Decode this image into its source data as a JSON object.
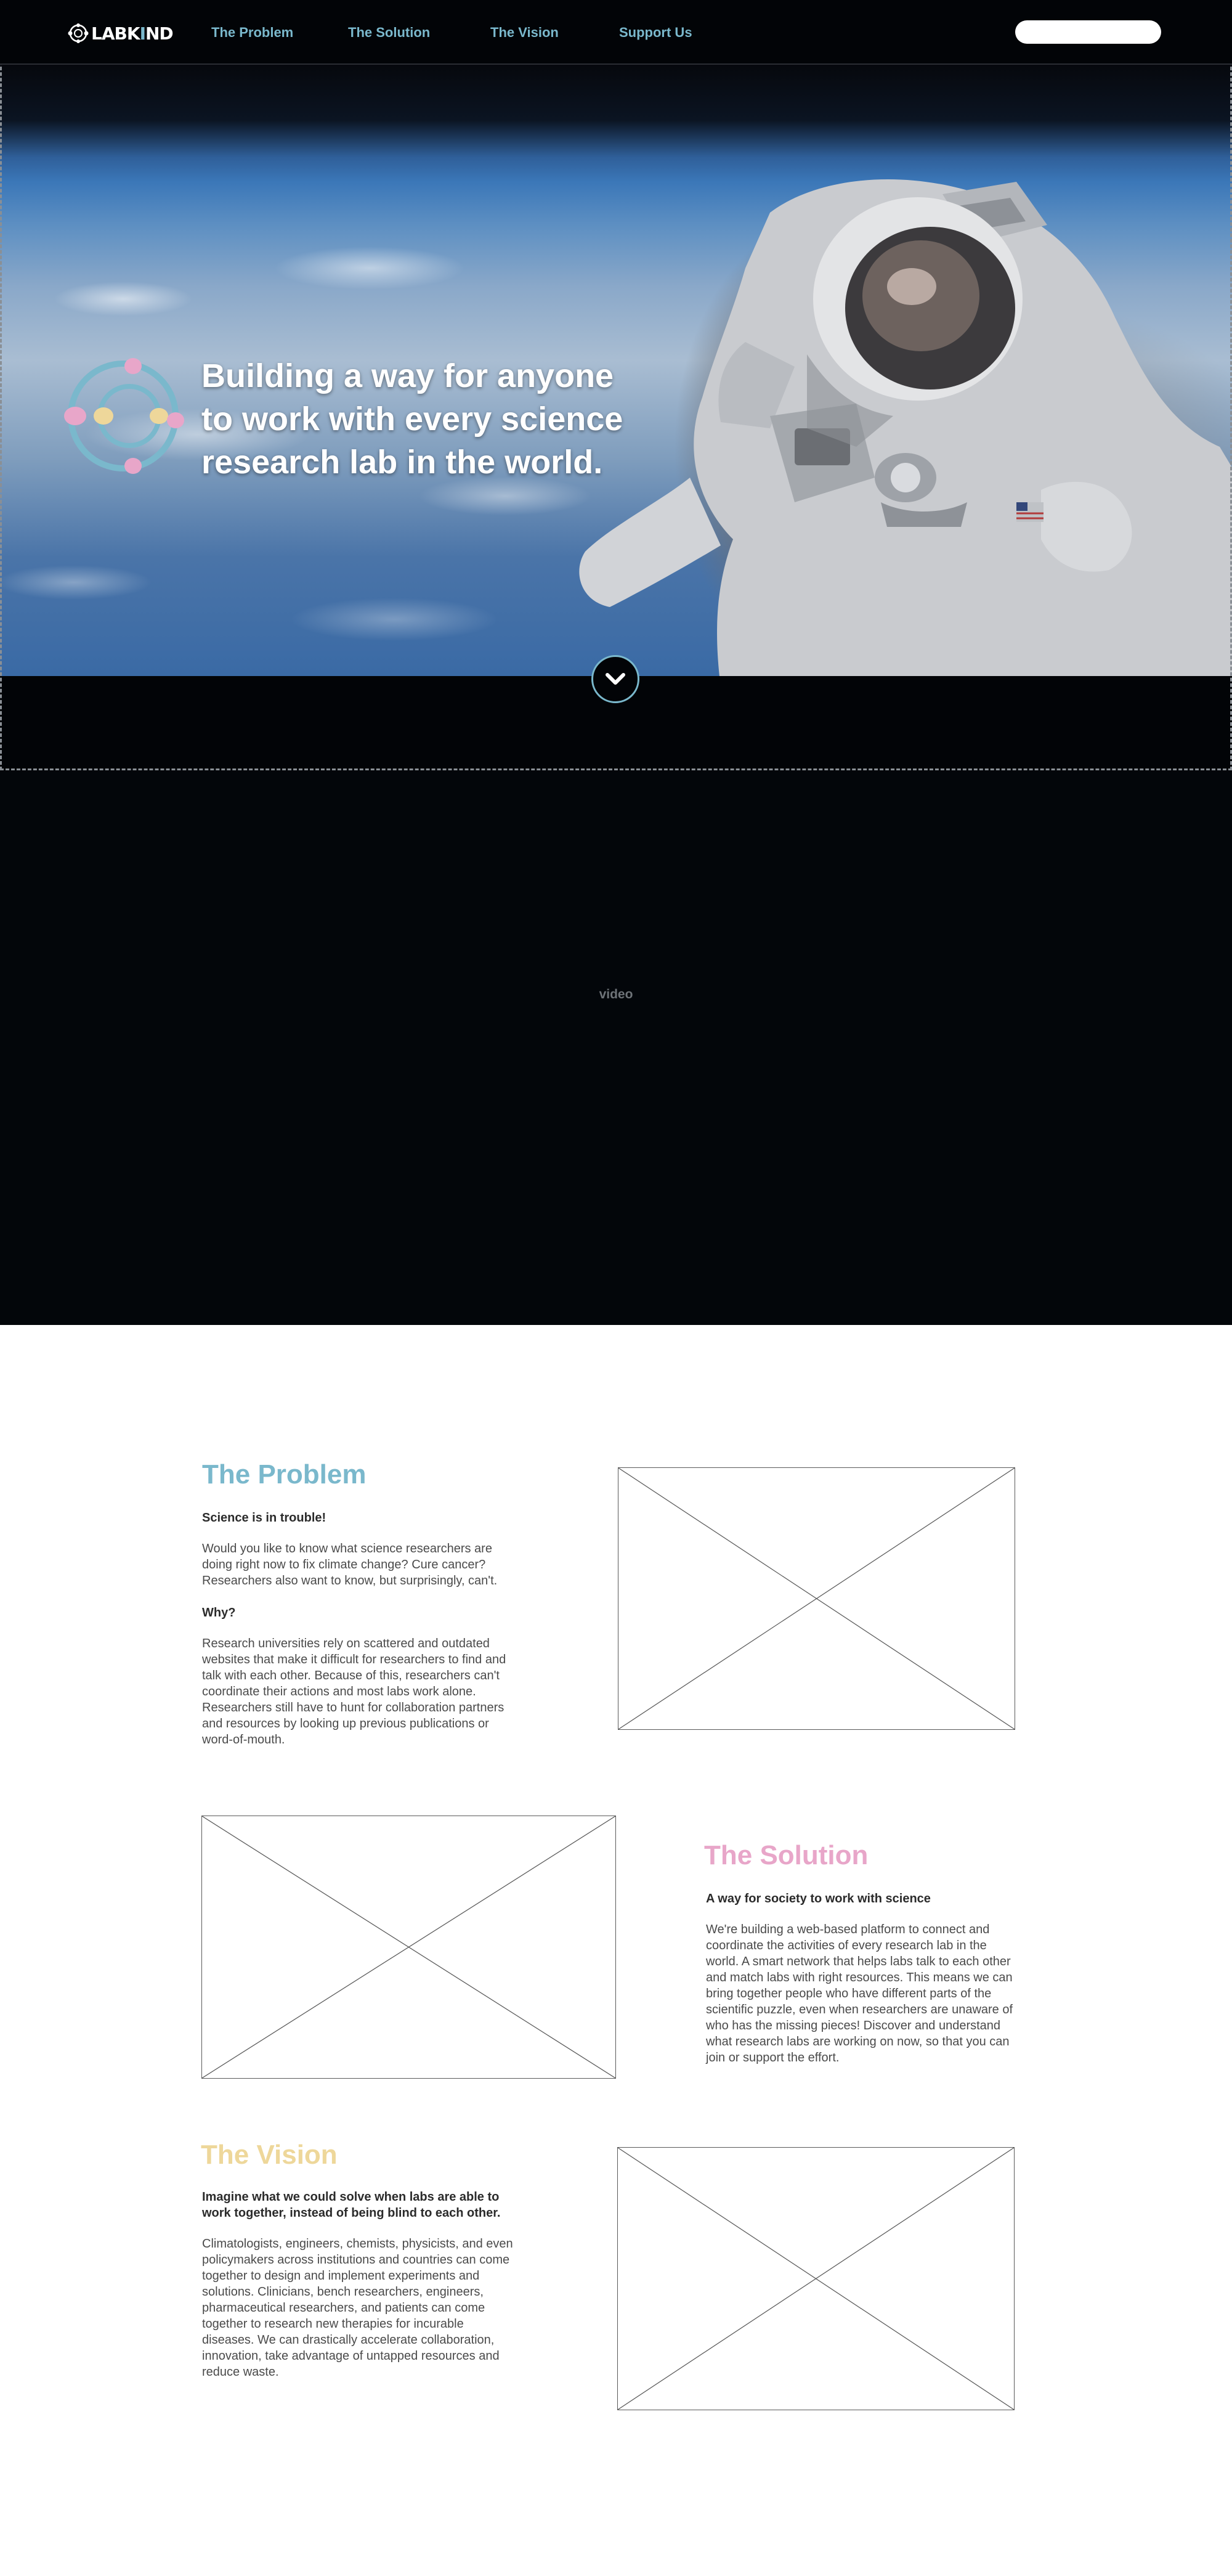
{
  "header": {
    "logo": {
      "text_primary": "LABK",
      "text_accent": "I",
      "text_secondary": "ND"
    },
    "nav": [
      {
        "label": "The Problem"
      },
      {
        "label": "The Solution"
      },
      {
        "label": "The Vision"
      },
      {
        "label": "Support Us"
      }
    ],
    "search": {
      "placeholder": ""
    }
  },
  "hero": {
    "title": "Building a way for anyone to work with every science research lab in the world.",
    "scroll_icon": "chevron-down-icon"
  },
  "video": {
    "label": "video"
  },
  "problem": {
    "title": "The Problem",
    "subtitle": "Science is in trouble!",
    "body1": "Would you like to know what science researchers are doing right now to fix climate change? Cure cancer? Researchers also want to know, but surprisingly, can't.",
    "subtitle2": "Why?",
    "body2": "Research universities rely on scattered and outdated websites that make it difficult for researchers to find and talk with each other. Because of this, researchers can't coordinate their actions and most labs work alone. Researchers still have to hunt for collaboration partners and resources by looking up previous publications or word-of-mouth."
  },
  "solution": {
    "title": "The Solution",
    "subtitle": "A way for society to work with science",
    "body": "We're building a web-based platform to connect and coordinate the activities of every research lab in the world. A smart network that helps labs talk to each other and match labs with right resources. This means we can bring together people who have different parts of the scientific puzzle, even when researchers are unaware of who has the missing pieces! Discover and understand what research labs are working on now, so that you can join or support the effort."
  },
  "vision": {
    "title": "The Vision",
    "subtitle": "Imagine what we could solve when labs are able to work together, instead of being blind to each other.",
    "body": "Climatologists, engineers, chemists, physicists, and even policymakers across institutions and countries can come together to design and implement experiments and solutions. Clinicians, bench researchers, engineers, pharmaceutical researchers, and patients can come together to research new therapies for incurable diseases. We can drastically accelerate collaboration, innovation, take advantage of untapped resources and reduce waste."
  },
  "colors": {
    "background_dark": "#020407",
    "accent_blue": "#7ab8cc",
    "accent_pink": "#e8a6c9",
    "accent_yellow": "#eed79a",
    "heading_dark": "#2b2b2b",
    "body_text": "#4a4a4a"
  }
}
